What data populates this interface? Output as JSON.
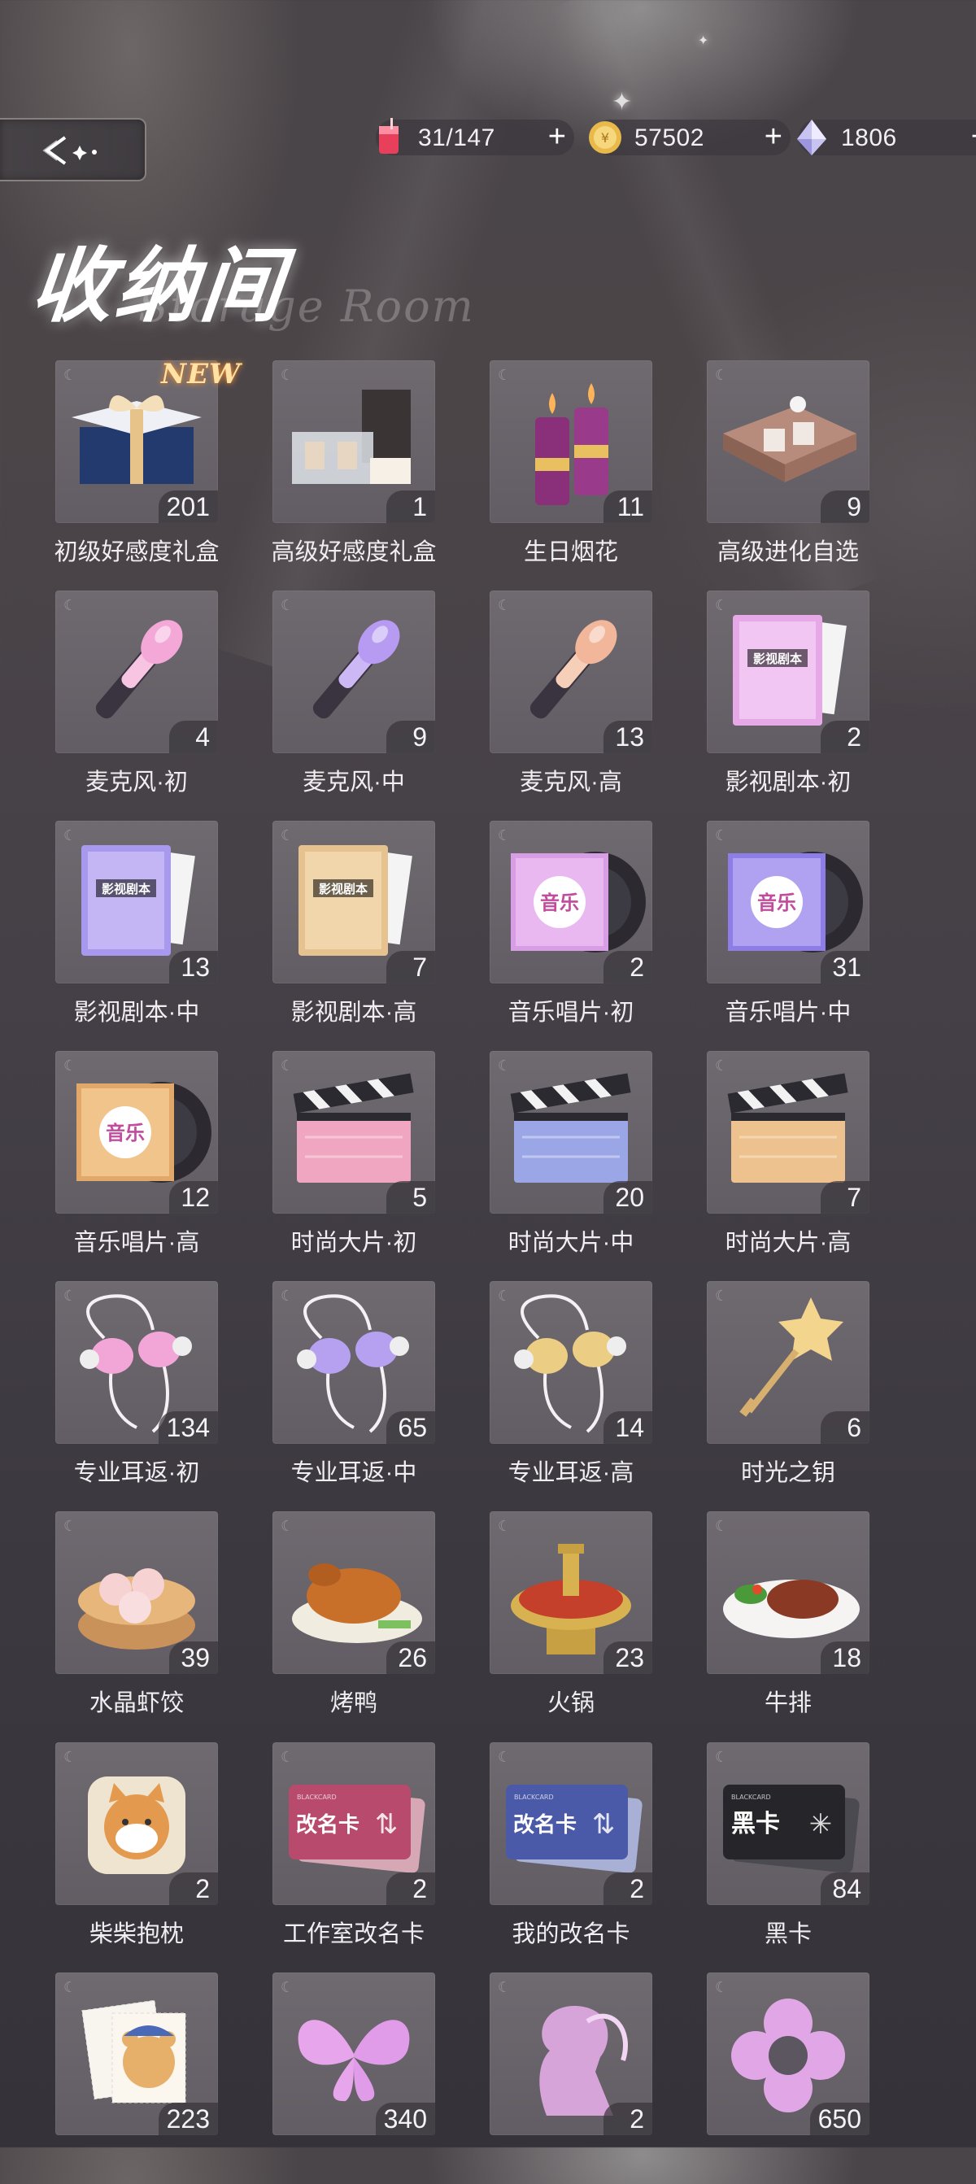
{
  "header": {
    "back_icon": "back-arrow-sparkle-icon",
    "resources": [
      {
        "icon": "drink-icon",
        "value": "31/147",
        "plus": "+"
      },
      {
        "icon": "gold-coin-icon",
        "value": "57502",
        "plus": "+"
      },
      {
        "icon": "diamond-icon",
        "value": "1806",
        "plus": "+"
      }
    ]
  },
  "title": "收纳间",
  "subtitle": "Storage Room",
  "new_badge": "NEW",
  "items": [
    {
      "name": "初级好感度礼盒",
      "count": "201",
      "icon": "gift-box-blue-icon"
    },
    {
      "name": "高级好感度礼盒",
      "count": "1",
      "icon": "gift-box-deluxe-icon"
    },
    {
      "name": "生日烟花",
      "count": "11",
      "icon": "firework-icon"
    },
    {
      "name": "高级进化自选",
      "count": "9",
      "icon": "selection-box-icon"
    },
    {
      "name": "麦克风·初",
      "count": "4",
      "icon": "microphone-pink-icon"
    },
    {
      "name": "麦克风·中",
      "count": "9",
      "icon": "microphone-purple-icon"
    },
    {
      "name": "麦克风·高",
      "count": "13",
      "icon": "microphone-gold-icon"
    },
    {
      "name": "影视剧本·初",
      "count": "2",
      "icon": "script-pink-icon"
    },
    {
      "name": "影视剧本·中",
      "count": "13",
      "icon": "script-purple-icon"
    },
    {
      "name": "影视剧本·高",
      "count": "7",
      "icon": "script-gold-icon"
    },
    {
      "name": "音乐唱片·初",
      "count": "2",
      "icon": "record-pink-icon"
    },
    {
      "name": "音乐唱片·中",
      "count": "31",
      "icon": "record-purple-icon"
    },
    {
      "name": "音乐唱片·高",
      "count": "12",
      "icon": "record-gold-icon"
    },
    {
      "name": "时尚大片·初",
      "count": "5",
      "icon": "clapperboard-pink-icon"
    },
    {
      "name": "时尚大片·中",
      "count": "20",
      "icon": "clapperboard-blue-icon"
    },
    {
      "name": "时尚大片·高",
      "count": "7",
      "icon": "clapperboard-gold-icon"
    },
    {
      "name": "专业耳返·初",
      "count": "134",
      "icon": "earphones-pink-icon"
    },
    {
      "name": "专业耳返·中",
      "count": "65",
      "icon": "earphones-purple-icon"
    },
    {
      "name": "专业耳返·高",
      "count": "14",
      "icon": "earphones-gold-icon"
    },
    {
      "name": "时光之钥",
      "count": "6",
      "icon": "star-key-icon"
    },
    {
      "name": "水晶虾饺",
      "count": "39",
      "icon": "dumpling-steamer-icon"
    },
    {
      "name": "烤鸭",
      "count": "26",
      "icon": "roast-duck-icon"
    },
    {
      "name": "火锅",
      "count": "23",
      "icon": "hotpot-icon"
    },
    {
      "name": "牛排",
      "count": "18",
      "icon": "steak-icon"
    },
    {
      "name": "柴柴抱枕",
      "count": "2",
      "icon": "shiba-pillow-icon"
    },
    {
      "name": "工作室改名卡",
      "count": "2",
      "icon": "rename-card-red-icon",
      "card_text": "改名卡"
    },
    {
      "name": "我的改名卡",
      "count": "2",
      "icon": "rename-card-blue-icon",
      "card_text": "改名卡"
    },
    {
      "name": "黑卡",
      "count": "84",
      "icon": "black-card-icon",
      "card_text": "黑卡"
    },
    {
      "name": "",
      "count": "223",
      "icon": "bear-stamps-icon"
    },
    {
      "name": "",
      "count": "340",
      "icon": "butterfly-icon"
    },
    {
      "name": "",
      "count": "2",
      "icon": "silhouette-icon"
    },
    {
      "name": "",
      "count": "650",
      "icon": "clover-icon"
    }
  ],
  "art_text": {
    "script": "影视剧本",
    "music": "音乐",
    "card_brand": "BLACKCARD"
  },
  "colors": {
    "background": "#46414a",
    "tile": "#68636a",
    "text": "#f1eef1"
  }
}
